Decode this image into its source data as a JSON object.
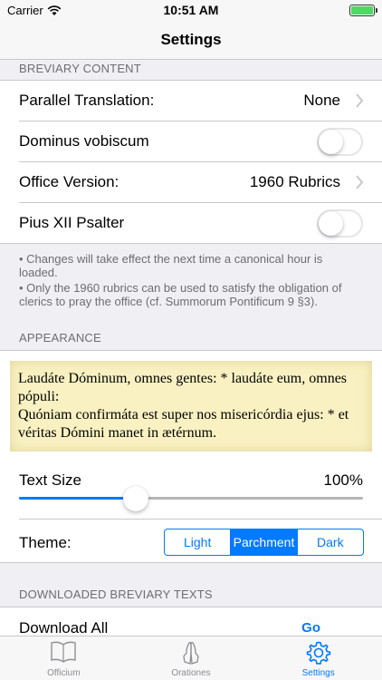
{
  "status_bar": {
    "carrier": "Carrier",
    "time": "10:51 AM"
  },
  "nav": {
    "title": "Settings"
  },
  "breviary_content": {
    "header": "BREVIARY CONTENT",
    "rows": {
      "parallel_translation": {
        "label": "Parallel Translation:",
        "value": "None"
      },
      "dominus_vobiscum": {
        "label": "Dominus vobiscum",
        "on": false
      },
      "office_version": {
        "label": "Office Version:",
        "value": "1960 Rubrics"
      },
      "pius_psalter": {
        "label": "Pius XII Psalter",
        "on": false
      }
    },
    "footnote_1": "• Changes will take effect the next time a canonical hour is loaded.",
    "footnote_2": "• Only the 1960 rubrics can be used to satisfy the obligation of clerics to pray the office (cf. Summorum Pontificum 9 §3)."
  },
  "appearance": {
    "header": "APPEARANCE",
    "preview_line_1": "Laudáte Dóminum, omnes gentes: * laudáte eum, omnes pópuli:",
    "preview_line_2": "Quóniam confirmáta est super nos misericórdia ejus: * et véritas Dómini manet in ætérnum.",
    "text_size": {
      "label": "Text Size",
      "value": "100%",
      "slider_fraction": 0.34
    },
    "theme": {
      "label": "Theme:",
      "options": [
        "Light",
        "Parchment",
        "Dark"
      ],
      "selected": "Parchment"
    }
  },
  "downloads": {
    "header": "DOWNLOADED BREVIARY TEXTS",
    "download_all_label": "Download All",
    "go_label": "Go"
  },
  "tabbar": {
    "items": [
      {
        "label": "Officium",
        "icon": "book-icon",
        "active": false
      },
      {
        "label": "Orationes",
        "icon": "praying-hands-icon",
        "active": false
      },
      {
        "label": "Settings",
        "icon": "gear-icon",
        "active": true
      }
    ]
  },
  "colors": {
    "accent": "#007aff",
    "parchment": "#f9f1c2",
    "background": "#efeff4"
  }
}
